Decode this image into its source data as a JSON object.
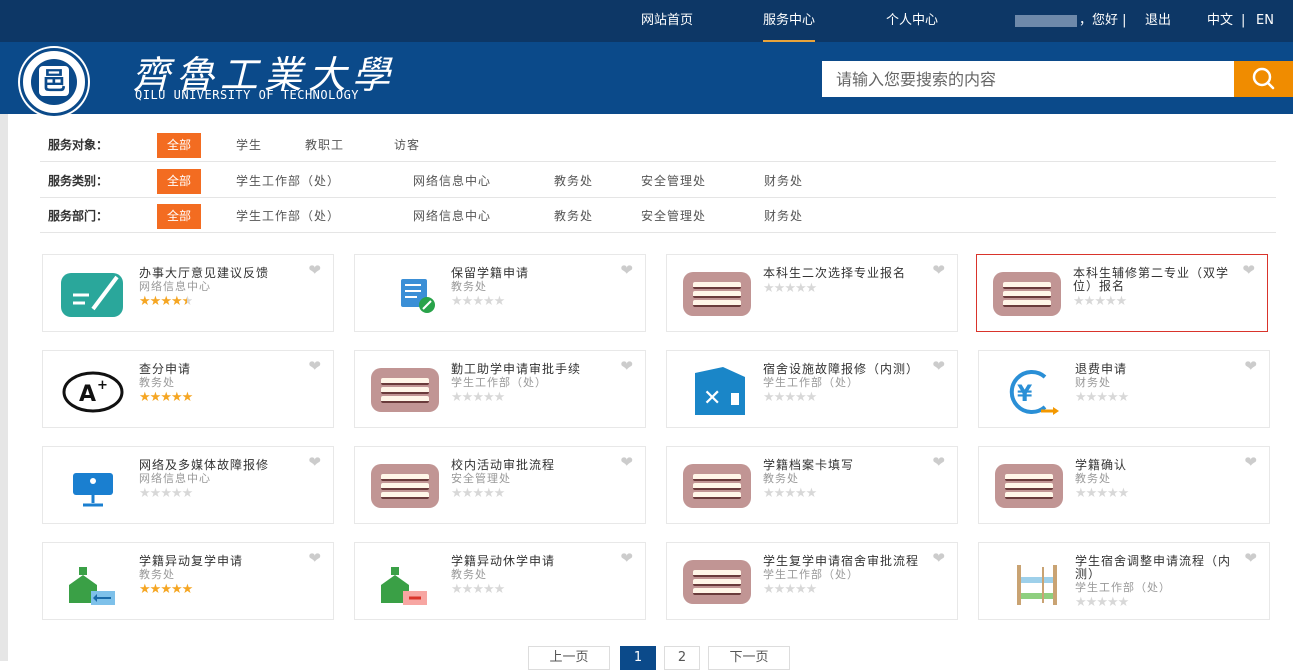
{
  "topnav": {
    "home": "网站首页",
    "service": "服务中心",
    "personal": "个人中心",
    "greeting": "，您好",
    "sep1": "|",
    "logout": "退出",
    "lang_cn": "中文",
    "sep2": "|",
    "lang_en": "EN"
  },
  "header": {
    "logo_title": "齊魯工業大學",
    "logo_sub": "QILU UNIVERSITY OF TECHNOLOGY",
    "search_placeholder": "请输入您要搜索的内容",
    "logo_char": "邑"
  },
  "filters": [
    {
      "label": "服务对象：",
      "options": [
        "全部",
        "学生",
        "教职工",
        "访客"
      ]
    },
    {
      "label": "服务类别：",
      "options": [
        "全部",
        "学生工作部（处）",
        "网络信息中心",
        "教务处",
        "安全管理处",
        "财务处"
      ]
    },
    {
      "label": "服务部门：",
      "options": [
        "全部",
        "学生工作部（处）",
        "网络信息中心",
        "教务处",
        "安全管理处",
        "财务处"
      ]
    }
  ],
  "cards": [
    {
      "title": "办事大厅意见建议反馈",
      "dept": "网络信息中心",
      "icon": "feedback-icon",
      "rating": 4.5
    },
    {
      "title": "保留学籍申请",
      "dept": "教务处",
      "icon": "document-icon",
      "rating": 0
    },
    {
      "title": "本科生二次选择专业报名",
      "dept": "",
      "icon": "books-icon",
      "rating": 0
    },
    {
      "title": "本科生辅修第二专业（双学位）报名",
      "dept": "",
      "icon": "books-icon",
      "rating": 0
    },
    {
      "title": "查分申请",
      "dept": "教务处",
      "icon": "grade-icon",
      "rating": 5
    },
    {
      "title": "勤工助学申请审批手续",
      "dept": "学生工作部（处）",
      "icon": "books-icon",
      "rating": 0
    },
    {
      "title": "宿舍设施故障报修（内测）",
      "dept": "学生工作部（处）",
      "icon": "repair-icon",
      "rating": 0
    },
    {
      "title": "退费申请",
      "dept": "财务处",
      "icon": "refund-icon",
      "rating": 0
    },
    {
      "title": "网络及多媒体故障报修",
      "dept": "网络信息中心",
      "icon": "monitor-icon",
      "rating": 0
    },
    {
      "title": "校内活动审批流程",
      "dept": "安全管理处",
      "icon": "books-icon",
      "rating": 0
    },
    {
      "title": "学籍档案卡填写",
      "dept": "教务处",
      "icon": "books-icon",
      "rating": 0
    },
    {
      "title": "学籍确认",
      "dept": "教务处",
      "icon": "books-icon",
      "rating": 0
    },
    {
      "title": "学籍异动复学申请",
      "dept": "教务处",
      "icon": "school-return-icon",
      "rating": 5
    },
    {
      "title": "学籍异动休学申请",
      "dept": "教务处",
      "icon": "school-suspend-icon",
      "rating": 0
    },
    {
      "title": "学生复学申请宿舍审批流程",
      "dept": "学生工作部（处）",
      "icon": "books-icon",
      "rating": 0
    },
    {
      "title": "学生宿舍调整申请流程（内测）",
      "dept": "学生工作部（处）",
      "icon": "bed-icon",
      "rating": 0
    }
  ],
  "pagination": {
    "prev": "上一页",
    "pages": [
      "1",
      "2"
    ],
    "current": "1",
    "next": "下一页"
  },
  "colors": {
    "nav": "#0d3766",
    "header": "#0b4a8a",
    "accent": "#f36c21",
    "search_btn": "#f08c00",
    "highlight_border": "#d9342b",
    "star": "#f5a623"
  }
}
